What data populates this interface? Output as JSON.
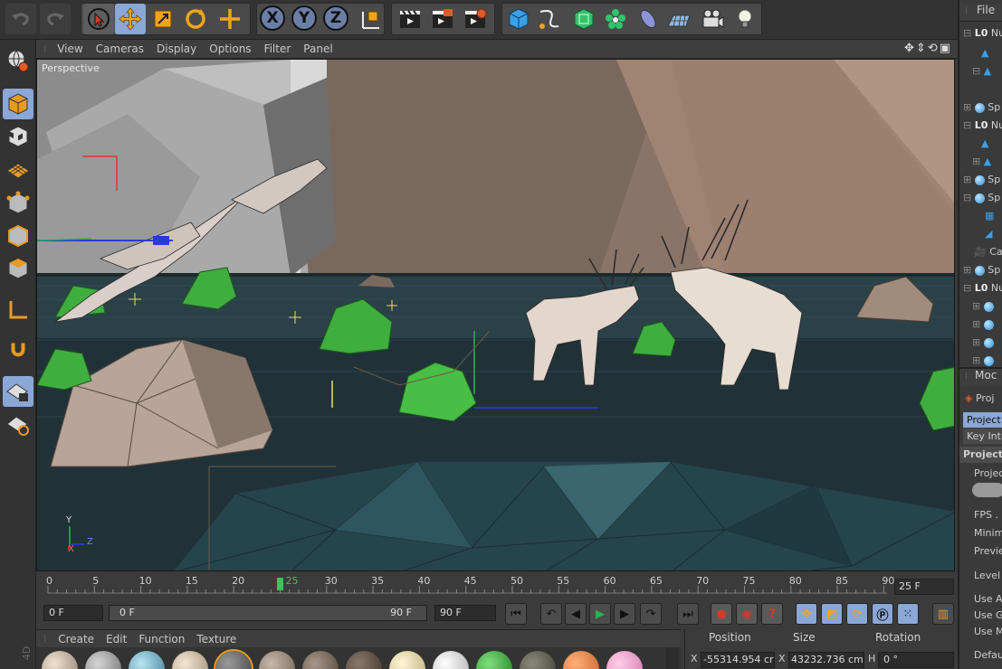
{
  "viewport": {
    "menu": [
      "View",
      "Cameras",
      "Display",
      "Options",
      "Filter",
      "Panel"
    ],
    "camera_label": "Perspective",
    "axis_labels": {
      "x": "X",
      "y": "Y",
      "z": "Z"
    }
  },
  "toolbar": {
    "axis_x": "X",
    "axis_y": "Y",
    "axis_z": "Z"
  },
  "timeline": {
    "ticks": [
      "0",
      "5",
      "10",
      "15",
      "20",
      "25",
      "30",
      "35",
      "40",
      "45",
      "50",
      "55",
      "60",
      "65",
      "70",
      "75",
      "80",
      "85",
      "90"
    ],
    "current_frame": "25",
    "fps": "25 F"
  },
  "playback": {
    "start_field": "0 F",
    "range_start": "0 F",
    "range_end": "90 F",
    "end_field": "90 F"
  },
  "material_menu": [
    "Create",
    "Edit",
    "Function",
    "Texture"
  ],
  "coordinates": {
    "headers": [
      "Position",
      "Size",
      "Rotation"
    ],
    "x_label": "X",
    "position_x": "-55314.954 cr",
    "size_label": "X",
    "size_x": "43232.736 cm",
    "rot_label": "H",
    "rot_h": "0 °"
  },
  "left_corner_label": "4D",
  "right_panel": {
    "file_menu": "File",
    "objects": [
      "Nu",
      "Sp",
      "Nu",
      "Sp",
      "Sp",
      "Ca",
      "Sp",
      "Nu"
    ],
    "mode_tab": "Moc",
    "project_label": "Proj",
    "tab_project": "Project",
    "tab_key": "Key Inte",
    "section_title": "Project S",
    "field_project": "Projec",
    "field_fps": "FPS . .",
    "field_min": "Minim",
    "field_preview": "Previe",
    "field_level": "Level c",
    "field_use1": "Use Ar",
    "field_use2": "Use G",
    "field_use3": "Use M",
    "field_default": "Defau"
  },
  "colors": {
    "accent_selected": "#8aa7d6",
    "timeline_marker": "#3cc45a",
    "record_red": "#d23a2a"
  }
}
